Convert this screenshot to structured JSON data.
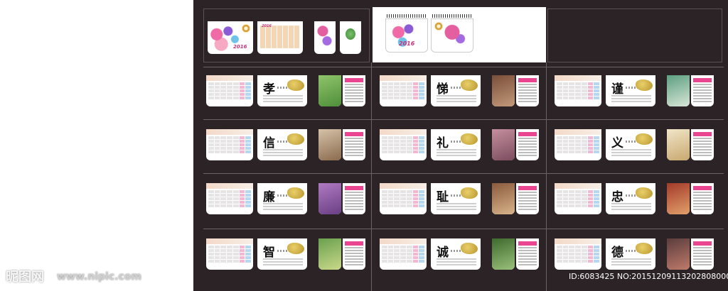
{
  "watermark": {
    "logo_text": "昵图网",
    "site": "www.nipic.com"
  },
  "image_id": "ID:6083425 NO:20151209113202808000",
  "virtues": [
    "孝",
    "悌",
    "谨",
    "信",
    "礼",
    "义",
    "廉",
    "耻",
    "忠",
    "智",
    "诚",
    "德"
  ],
  "cover": {
    "year": "2016"
  },
  "colors": {
    "sheet_bg": "#2b2326",
    "accent_pink": "#e94591",
    "gold": "#d8a23d"
  }
}
